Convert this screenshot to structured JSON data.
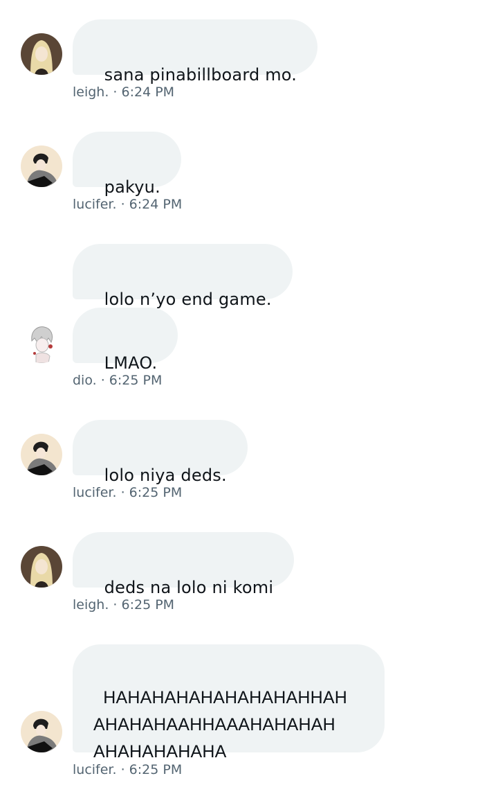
{
  "messages": [
    {
      "text": "sana pinabillboard mo.",
      "avatar": "leigh-avatar"
    },
    {
      "text": "pakyu.",
      "avatar": "lucifer-avatar"
    },
    {
      "text": "lolo n’yo end game.",
      "avatar": ""
    },
    {
      "text": "LMAO.",
      "avatar": "dio-avatar"
    },
    {
      "text": "lolo niya deds.",
      "avatar": "lucifer-avatar"
    },
    {
      "text": "deds na lolo ni komi",
      "avatar": "leigh-avatar"
    },
    {
      "text": "HAHAHAHAHAHAHAHAHHAH\nAHAHAHAAHHAAAHAHAHAH\nAHAHAHAHAHA",
      "avatar": "lucifer-avatar"
    }
  ],
  "meta": [
    {
      "author": "leigh.",
      "time": "6:24 PM",
      "line": "leigh. · 6:24 PM"
    },
    {
      "author": "lucifer.",
      "time": "6:24 PM",
      "line": "lucifer. · 6:24 PM"
    },
    {
      "author": "dio.",
      "time": "6:25 PM",
      "line": "dio. · 6:25 PM"
    },
    {
      "author": "lucifer.",
      "time": "6:25 PM",
      "line": "lucifer. · 6:25 PM"
    },
    {
      "author": "leigh.",
      "time": "6:25 PM",
      "line": "leigh. · 6:25 PM"
    },
    {
      "author": "lucifer.",
      "time": "6:25 PM",
      "line": "lucifer. · 6:25 PM"
    }
  ],
  "colors": {
    "bubble": "#eff3f4",
    "text": "#0f1419",
    "meta": "#536471"
  }
}
